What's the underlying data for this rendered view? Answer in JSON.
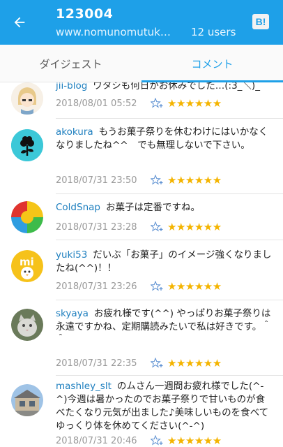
{
  "header": {
    "title": "123004",
    "url": "www.nomunomutuk…",
    "users": "12 users",
    "hatena_label": "B!"
  },
  "tabs": [
    {
      "label": "ダイジェスト",
      "active": false
    },
    {
      "label": "コメント",
      "active": true
    }
  ],
  "colors": {
    "accent": "#1ea0e8",
    "star": "#f4b400",
    "username": "#1e7fbf"
  },
  "comments": [
    {
      "user": "jii-blog",
      "text": "ワタシも何日かお休みでした…(:3_＼)_",
      "date": "2018/08/01 05:52",
      "stars": "★★★★★★"
    },
    {
      "user": "akokura",
      "text": "もうお菓子祭りを休むわけにはいかなくなりましたね^^　でも無理しないで下さい。",
      "date": "2018/07/31 23:50",
      "stars": "★★★★★★"
    },
    {
      "user": "ColdSnap",
      "text": "お菓子は定番ですね。",
      "date": "2018/07/31 23:28",
      "stars": "★★★★★★"
    },
    {
      "user": "yuki53",
      "text": "だいぶ「お菓子」のイメージ強くなりましたね(^^)！！",
      "date": "2018/07/31 23:26",
      "stars": "★★★★★★"
    },
    {
      "user": "skyaya",
      "text": "お疲れ様です(^^) やっぱりお菓子祭りは永遠ですかね、定期購読みたいで私は好きです。＾＾",
      "date": "2018/07/31 22:35",
      "stars": "★★★★★★"
    },
    {
      "user": "mashley_slt",
      "text": "のムさん一週間お疲れ様でした(^-^)今週は暑かったのでお菓子祭りで甘いものが食べたくなり元気が出ました♪美味しいものを食べてゆっくり体を休めてください(^-^)",
      "date": "2018/07/31 20:46",
      "stars": "★★★★★★"
    }
  ]
}
